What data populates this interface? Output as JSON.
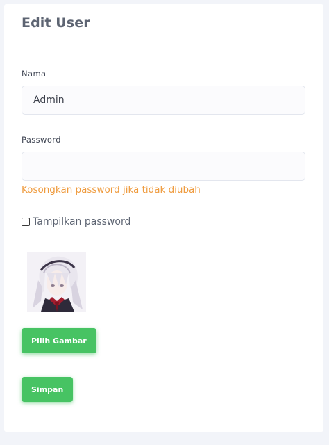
{
  "page": {
    "title": "Edit User"
  },
  "form": {
    "name_label": "Nama",
    "name_value": "Admin",
    "password_label": "Password",
    "password_value": "",
    "password_hint": "Kosongkan password jika tidak diubah",
    "show_password_label": "Tampilkan password",
    "show_password_checked": false,
    "choose_image_label": "Pilih Gambar",
    "save_label": "Simpan"
  },
  "colors": {
    "accent": "#47c363",
    "hint": "#ef9b3e",
    "background": "#f2f4f9"
  }
}
